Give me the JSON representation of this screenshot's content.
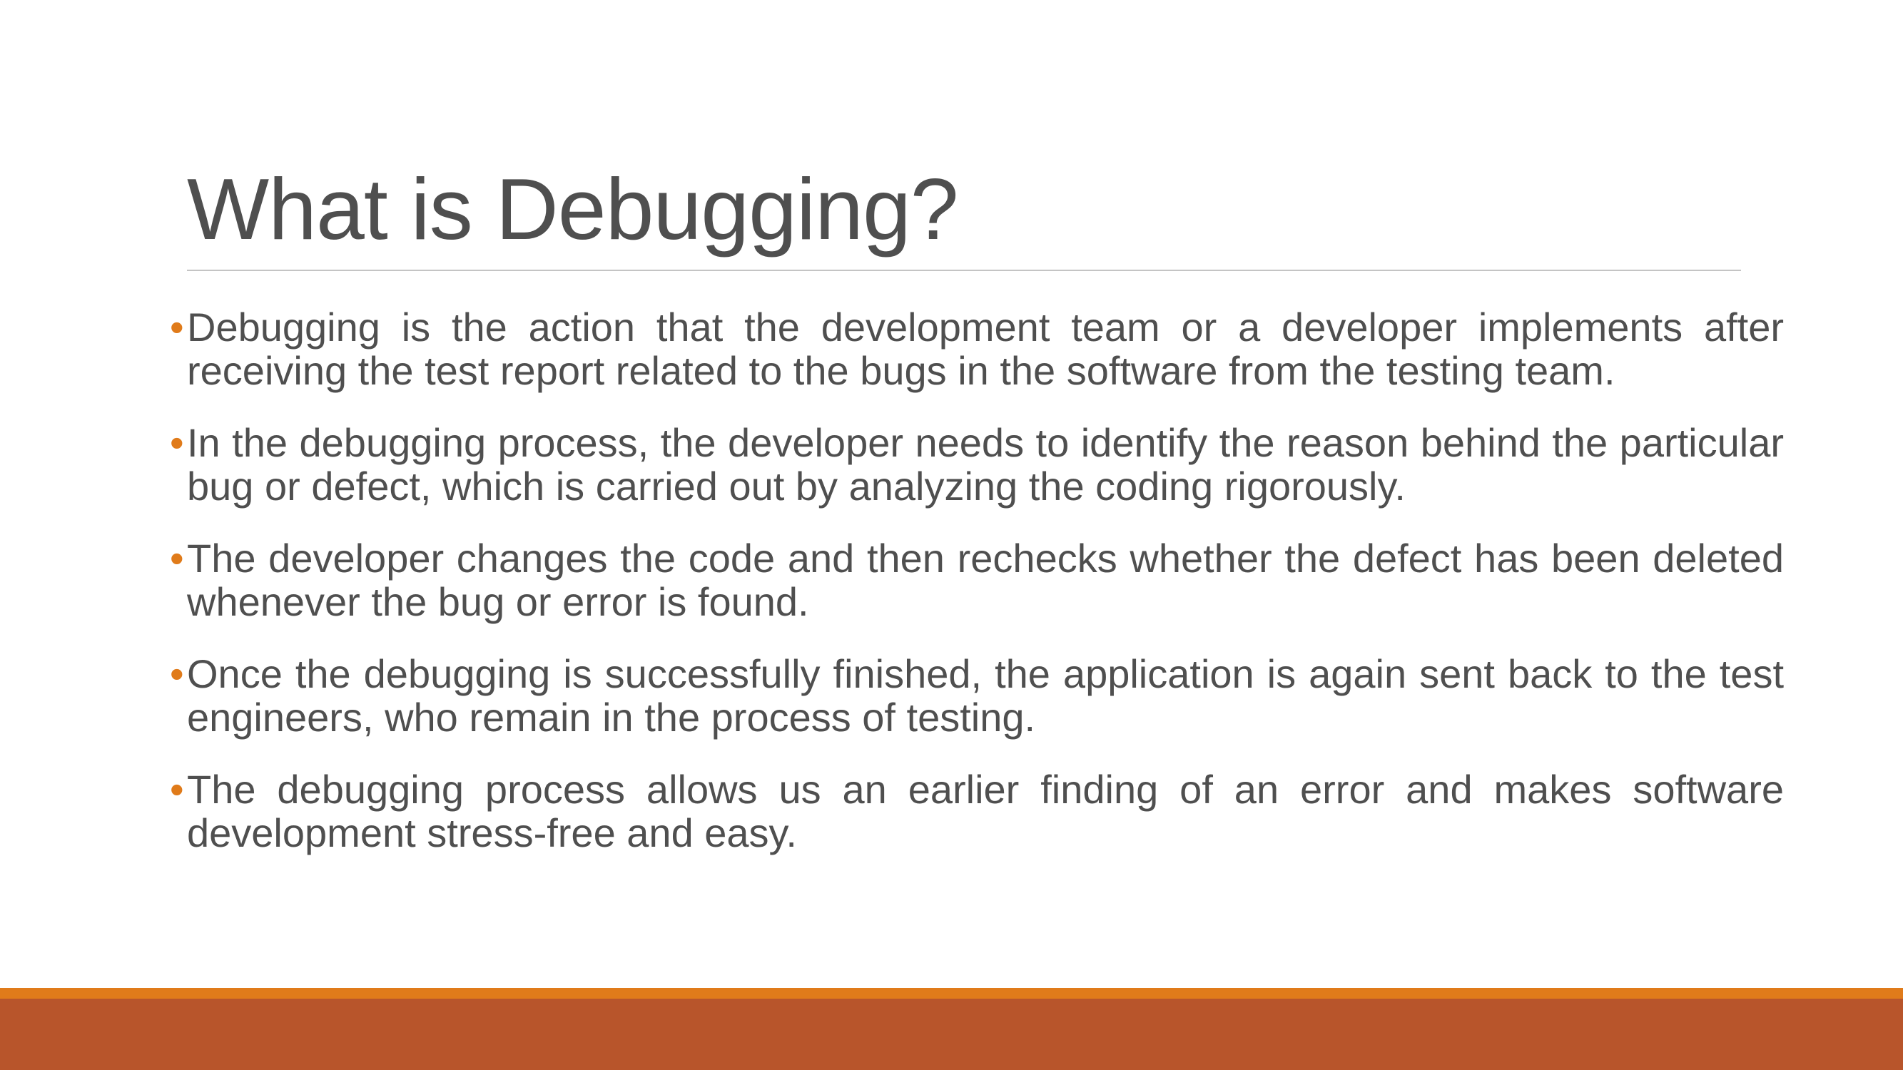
{
  "slide": {
    "title": "What is Debugging?",
    "bullet_glyph": "•",
    "bullets": [
      "Debugging is the action that the development team or a developer implements after receiving the test report related to the bugs in the software from the testing team.",
      "In the debugging process, the developer needs to identify the reason behind the particular bug or defect, which is carried out by analyzing the coding rigorously.",
      "The developer changes the code and then rechecks whether the defect has been deleted whenever the bug or error is found.",
      "Once the debugging is successfully finished, the application is again sent back to the test engineers, who remain in the process of testing.",
      "The debugging process allows us an earlier finding of an error and makes software development stress-free and easy."
    ]
  },
  "colors": {
    "text": "#4f4f4f",
    "accent_orange": "#e07b1a",
    "accent_rust": "#b8552b",
    "rule": "#c4c4c4",
    "background": "#ffffff"
  }
}
